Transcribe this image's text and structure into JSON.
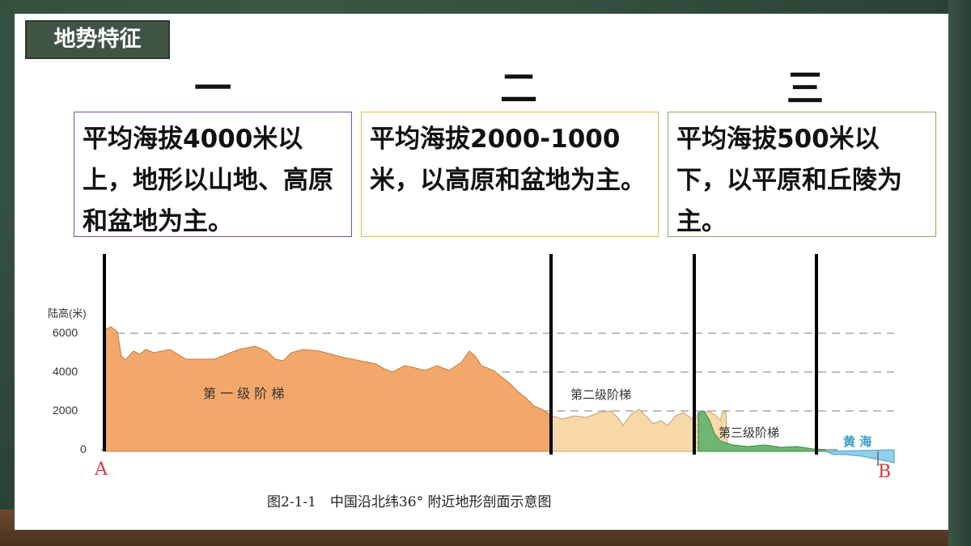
{
  "title": "地势特征",
  "steps": [
    {
      "numeral": "一",
      "text": "平均海拔4000米以上，地形以山地、高原和盆地为主。",
      "border_color": "#7a4d9a"
    },
    {
      "numeral": "二",
      "text": "平均海拔2000-1000米，以高原和盆地为主。",
      "border_color": "#e0c040"
    },
    {
      "numeral": "三",
      "text": "平均海拔500米以下，以平原和丘陵为主。",
      "border_color": "#8aa868"
    }
  ],
  "figure": {
    "caption": "图2-1-1　中国沿北纬36° 附近地形剖面示意图",
    "y_axis_label": "陆高(米)",
    "y_ticks": [
      "6000",
      "4000",
      "2000",
      "0"
    ],
    "region_labels": [
      "第 一 级 阶 梯",
      "第二级阶梯",
      "第三级阶梯",
      "黄 海"
    ],
    "endpoint_labels": [
      "A",
      "B"
    ],
    "colors": {
      "step1": "#f2a86a",
      "step2": "#f7d8a8",
      "step3": "#6fb673",
      "sea": "#8fd0e8"
    }
  }
}
